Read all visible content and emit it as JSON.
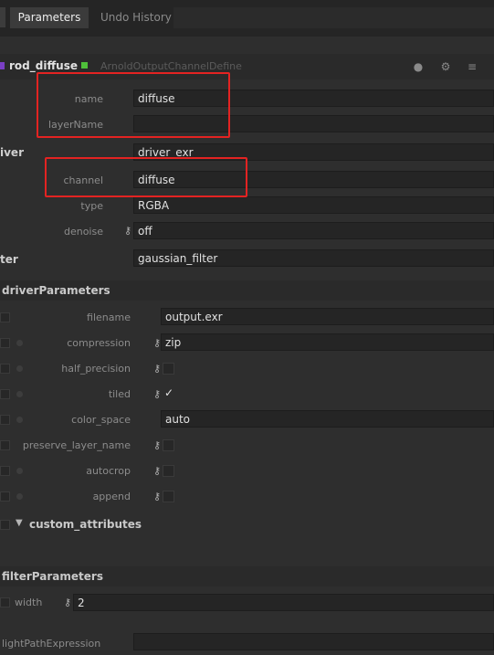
{
  "tabs": {
    "parameters": "Parameters",
    "undo_history": "Undo History"
  },
  "node": {
    "name": "rod_diffuse",
    "class": "ArnoldOutputChannelDefine"
  },
  "params": {
    "name": {
      "label": "name",
      "value": "diffuse"
    },
    "layerName": {
      "label": "layerName",
      "value": ""
    },
    "driver": {
      "label": "iver",
      "value": "driver_exr"
    },
    "channel": {
      "label": "channel",
      "value": "diffuse"
    },
    "type": {
      "label": "type",
      "value": "RGBA"
    },
    "denoise": {
      "label": "denoise",
      "value": "off"
    },
    "filter": {
      "label": "ter",
      "value": "gaussian_filter"
    }
  },
  "driverParameters": {
    "title": "driverParameters",
    "filename": {
      "label": "filename",
      "value": "output.exr"
    },
    "compression": {
      "label": "compression",
      "value": "zip"
    },
    "half_precision": {
      "label": "half_precision"
    },
    "tiled": {
      "label": "tiled",
      "value": "✓"
    },
    "color_space": {
      "label": "color_space",
      "value": "auto"
    },
    "preserve_layer_name": {
      "label": "preserve_layer_name"
    },
    "autocrop": {
      "label": "autocrop"
    },
    "append": {
      "label": "append"
    }
  },
  "custom_attributes": {
    "title": "custom_attributes"
  },
  "filterParameters": {
    "title": "filterParameters",
    "width": {
      "label": "width",
      "value": "2"
    }
  },
  "lightPathExpression": {
    "label": "lightPathExpression",
    "value": ""
  },
  "colors": {
    "highlight": "#e32322",
    "marker_purple": "#7a3fc4",
    "marker_green": "#4fbf3a"
  }
}
